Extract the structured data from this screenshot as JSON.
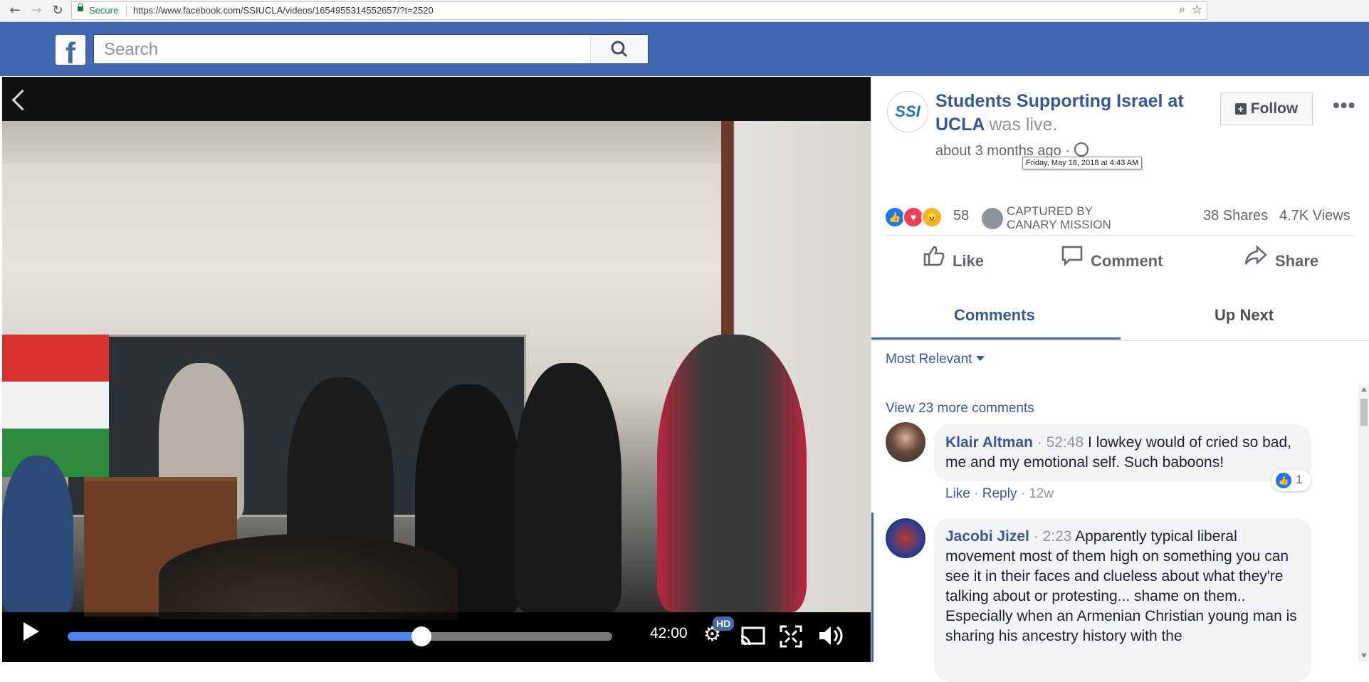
{
  "browser": {
    "secure_label": "Secure",
    "url": "https://www.facebook.com/SSIUCLA/videos/1654955314552657/?t=2520"
  },
  "header": {
    "logo": "f",
    "search_placeholder": "Search"
  },
  "video": {
    "time": "42:00",
    "hd_label": "HD",
    "progress": 0.65
  },
  "post": {
    "avatar_text": "SSI",
    "page_name": "Students Supporting Israel at UCLA",
    "status": "was live.",
    "time": "about 3 months ago ·",
    "tooltip": "Friday, May 18, 2018 at 4:43 AM",
    "follow_label": "Follow",
    "more_label": "•••",
    "reaction_count": "58",
    "captured_line1": "CAPTURED BY",
    "captured_line2": "CANARY MISSION",
    "shares": "38 Shares",
    "views": "4.7K Views"
  },
  "actions": {
    "like": "Like",
    "comment": "Comment",
    "share": "Share"
  },
  "tabs": {
    "comments": "Comments",
    "up_next": "Up Next"
  },
  "comments_section": {
    "sort_label": "Most Relevant",
    "view_more": "View 23 more comments",
    "items": [
      {
        "author": "Klair Altman",
        "timestamp": "52:48",
        "text": "I lowkey would of cried so bad, me and my emotional self. Such baboons!",
        "like": "Like",
        "reply": "Reply",
        "age": "12w",
        "like_count": "1"
      },
      {
        "author": "Jacobi Jizel",
        "timestamp": "2:23",
        "text": "Apparently typical liberal movement most of them high on something you can see it in their faces and clueless about what they're talking about or protesting... shame on them..",
        "text2": "Especially when an Armenian Christian young man is sharing his ancestry history with the"
      }
    ]
  },
  "colors": {
    "facebook_blue": "#4267b2",
    "link_blue": "#365899",
    "progress_blue": "#4a85f2"
  }
}
